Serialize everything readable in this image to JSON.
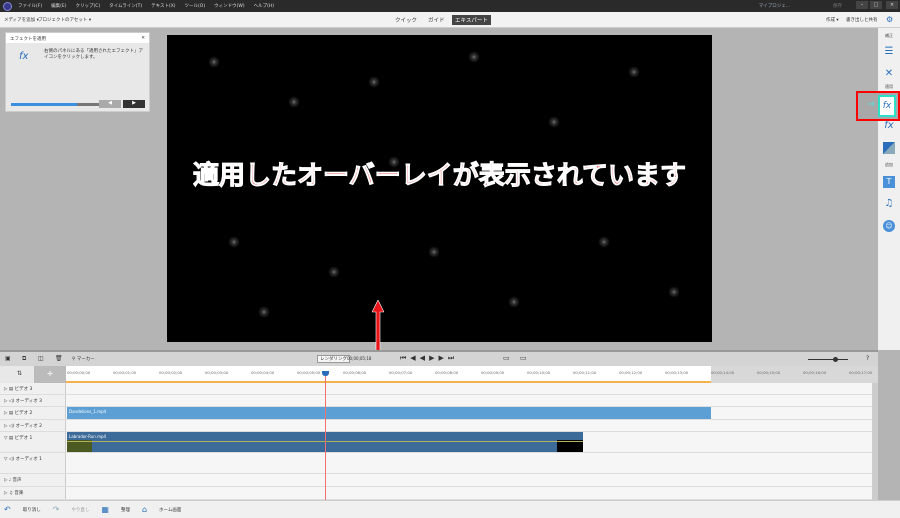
{
  "menu": [
    "ファイル(F)",
    "編集(E)",
    "クリップ(C)",
    "タイムライン(T)",
    "テキスト(X)",
    "ツール(O)",
    "ウィンドウ(W)",
    "ヘルプ(H)"
  ],
  "window": {
    "title": "マイプロジェ...",
    "save": "保存"
  },
  "toolbar": {
    "add_media": "メディアを追加 ▾",
    "project_assets": "プロジェクトのアセット ▾",
    "create": "作成 ▾",
    "export": "書き出しと共有"
  },
  "modes": [
    "クイック",
    "ガイド",
    "エキスパート"
  ],
  "guide_panel": {
    "title": "エフェクトを適用",
    "text": "右側のパネルにある「適用されたエフェクト」アイコンをクリックします。",
    "progress": 0.75
  },
  "overlay_text": "適用したオーバーレイが表示されています",
  "right_panel": {
    "labels": [
      "補正",
      "適用",
      "追加"
    ]
  },
  "timeline": {
    "marker": "マーカー",
    "render": "レンダリング",
    "timecode": "00;00;05;18",
    "ticks": [
      "00;00;00;00",
      "00;00;01;00",
      "00;00;02;00",
      "00;00;03;00",
      "00;00;04;00",
      "00;00;05;00",
      "00;00;06;00",
      "00;00;07;00",
      "00;00;08;00",
      "00;00;09;00",
      "00;00;10;00",
      "00;00;11;00",
      "00;00;12;00",
      "00;00;13;00",
      "00;00;14;00",
      "00;00;15;00",
      "00;00;16;00",
      "00;00;17;00"
    ],
    "tracks": [
      "ビデオ 3",
      "オーディオ 3",
      "ビデオ 2",
      "オーディオ 2",
      "ビデオ 1",
      "オーディオ 1",
      "音声",
      "音楽"
    ],
    "clips": {
      "v2": "Dandelions_1.mp4",
      "v1": "Labrador-Run.mp4"
    }
  },
  "bottom": {
    "undo": "取り消し",
    "redo": "やり直し",
    "organizer": "整理",
    "home": "ホーム画面"
  },
  "colors": {
    "accent": "#2a6ebb",
    "overlay": "#e8161b",
    "clip_v2": "#5b9fd4",
    "clip_v1": "#3d6b99"
  }
}
